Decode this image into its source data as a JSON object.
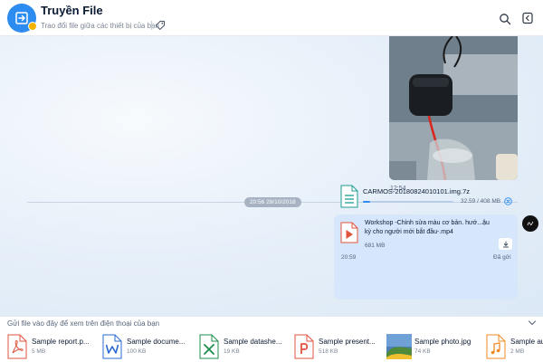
{
  "header": {
    "title": "Truyền File",
    "subtitle": "Trao đổi file giữa các thiết bị của bạn",
    "app_icon": "transfer-arrow-icon",
    "search_icon": "search-icon",
    "panel_icon": "side-panel-icon",
    "tag_icon": "tag-icon"
  },
  "chat": {
    "photo_time": "12:54",
    "date_divider": "20:56 29/10/2018",
    "message": {
      "file1": {
        "name": "CARMOS-20180824010101.img.7z",
        "progress_text": "32.59 / 408 MB",
        "progress_fraction": 0.08
      },
      "file2": {
        "title": "Workshop -Chỉnh sửa màu cơ bản. hướ...ậu kỳ cho người mới bắt đầu-.mp4",
        "size": "681 MB"
      },
      "time": "20:59",
      "status": "Đã gửi"
    }
  },
  "tray": {
    "hint": "Gửi file vào đây để xem trên điện thoại của bạn",
    "files": [
      {
        "name": "Sample report.p...",
        "size": "5 MB",
        "type": "pdf",
        "color": "#e0533d"
      },
      {
        "name": "Sample docume...",
        "size": "100 KB",
        "type": "word",
        "color": "#2b6bd1"
      },
      {
        "name": "Sample datashe...",
        "size": "19 KB",
        "type": "excel",
        "color": "#1e8e4c"
      },
      {
        "name": "Sample present...",
        "size": "518 KB",
        "type": "powerpoint",
        "color": "#e0533d"
      },
      {
        "name": "Sample photo.jpg",
        "size": "74 KB",
        "type": "image",
        "color": "#6a9a3a"
      },
      {
        "name": "Sample au",
        "size": "2 MB",
        "type": "audio",
        "color": "#f08a24"
      }
    ]
  },
  "colors": {
    "accent": "#2d8cf0",
    "bubble": "#d6e6fb",
    "chat_bg": "#dbe8f5"
  }
}
